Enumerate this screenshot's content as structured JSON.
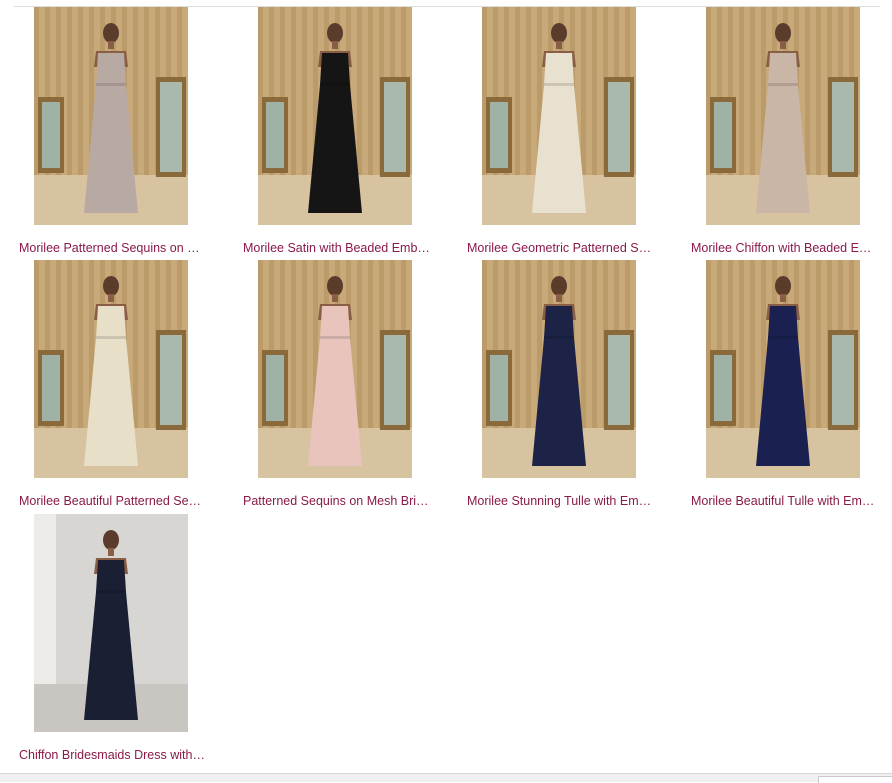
{
  "products": [
    {
      "title": "Morilee Patterned Sequins on …",
      "gown_color": "#b9a9a3",
      "backdrop": "curtain-gold"
    },
    {
      "title": "Morilee Satin with Beaded Emb…",
      "gown_color": "#151515",
      "backdrop": "curtain-gold"
    },
    {
      "title": "Morilee Geometric Patterned S…",
      "gown_color": "#e9e1d0",
      "backdrop": "curtain-gold"
    },
    {
      "title": "Morilee Chiffon with Beaded E…",
      "gown_color": "#c9b6a6",
      "backdrop": "curtain-gold"
    },
    {
      "title": "Morilee Beautiful Patterned Seq…",
      "gown_color": "#e8dfc9",
      "backdrop": "curtain-gold"
    },
    {
      "title": "Patterned Sequins on Mesh Bri…",
      "gown_color": "#e8c4bd",
      "backdrop": "curtain-gold"
    },
    {
      "title": "Morilee Stunning Tulle with Em…",
      "gown_color": "#1c2347",
      "backdrop": "curtain-gold"
    },
    {
      "title": "Morilee Beautiful Tulle with Em…",
      "gown_color": "#1a2150",
      "backdrop": "curtain-gold"
    },
    {
      "title": "Chiffon Bridesmaids Dress with…",
      "gown_color": "#1b1f33",
      "backdrop": "plain-gray"
    }
  ]
}
